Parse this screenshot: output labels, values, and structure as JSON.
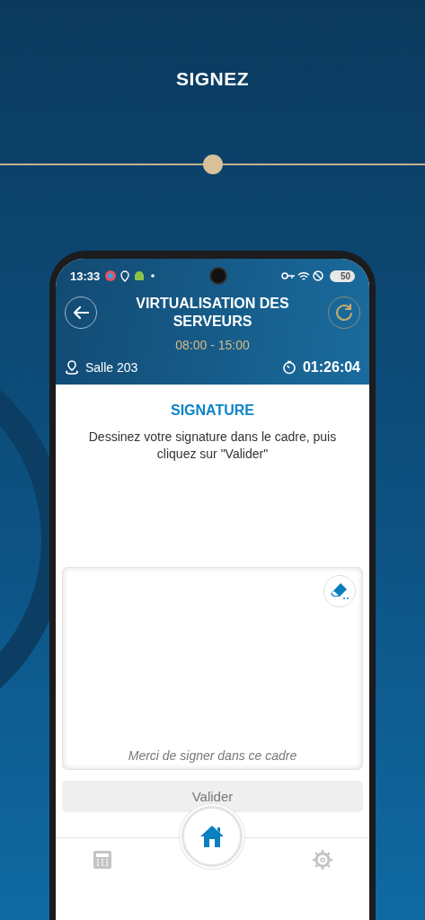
{
  "page_title": "SIGNEZ",
  "status_bar": {
    "time": "13:33",
    "battery": "50"
  },
  "header": {
    "title": "VIRTUALISATION DES SERVEURS",
    "schedule": "08:00 - 15:00",
    "room": "Salle 203",
    "timer": "01:26:04"
  },
  "signature": {
    "heading": "SIGNATURE",
    "instructions": "Dessinez votre signature dans le cadre, puis cliquez sur \"Valider\"",
    "pad_placeholder": "Merci de signer dans ce cadre",
    "submit": {
      "label": "Valider",
      "disabled": true
    }
  },
  "bottom_nav": [
    {
      "kind": "calculator",
      "selected": false
    },
    {
      "kind": "home",
      "selected": true
    },
    {
      "kind": "settings",
      "selected": false
    }
  ]
}
